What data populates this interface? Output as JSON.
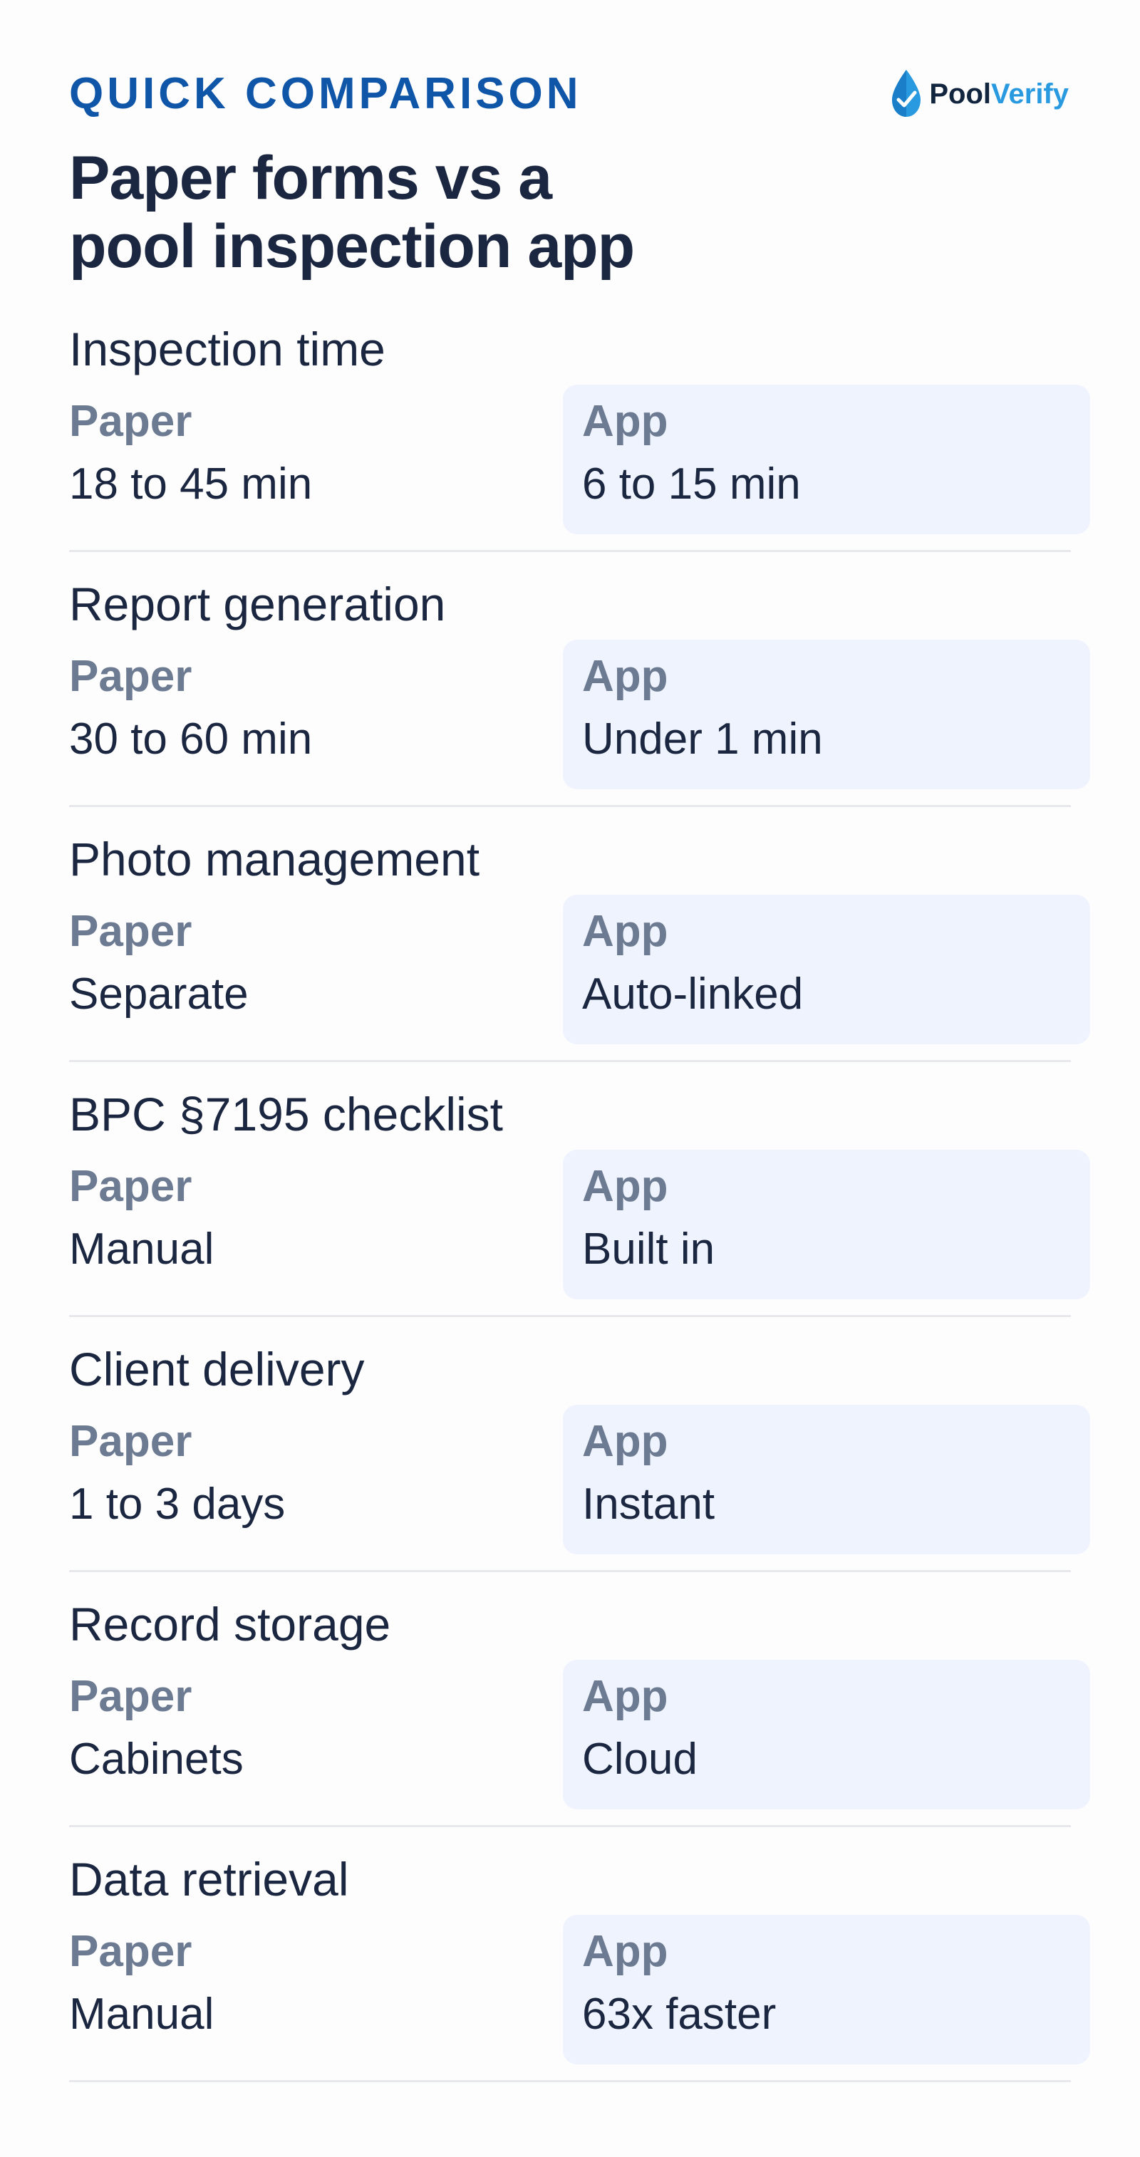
{
  "header": {
    "eyebrow": "QUICK COMPARISON",
    "headline_line1": "Paper forms vs a",
    "headline_line2": "pool inspection app",
    "logo": {
      "icon": "water-drop-check-icon",
      "text_part1": "Pool",
      "text_part2": "Verify",
      "colors": {
        "dark": "#12253f",
        "accent": "#2a9ae0"
      }
    }
  },
  "colors": {
    "eyebrow": "#0f56a8",
    "text": "#1b2640",
    "muted_label": "#6c7a92",
    "app_card_bg": "#eef3fd",
    "divider": "#e6e8ec"
  },
  "rows": [
    {
      "title": "Inspection time",
      "paper_label": "Paper",
      "paper_value": "18 to 45 min",
      "app_label": "App",
      "app_value": "6 to 15 min"
    },
    {
      "title": "Report generation",
      "paper_label": "Paper",
      "paper_value": "30 to 60 min",
      "app_label": "App",
      "app_value": "Under 1 min"
    },
    {
      "title": "Photo management",
      "paper_label": "Paper",
      "paper_value": "Separate",
      "app_label": "App",
      "app_value": "Auto-linked"
    },
    {
      "title": "BPC §7195 checklist",
      "paper_label": "Paper",
      "paper_value": "Manual",
      "app_label": "App",
      "app_value": "Built in"
    },
    {
      "title": "Client delivery",
      "paper_label": "Paper",
      "paper_value": "1 to 3 days",
      "app_label": "App",
      "app_value": "Instant"
    },
    {
      "title": "Record storage",
      "paper_label": "Paper",
      "paper_value": "Cabinets",
      "app_label": "App",
      "app_value": "Cloud"
    },
    {
      "title": "Data retrieval",
      "paper_label": "Paper",
      "paper_value": "Manual",
      "app_label": "App",
      "app_value": "63x faster"
    }
  ]
}
